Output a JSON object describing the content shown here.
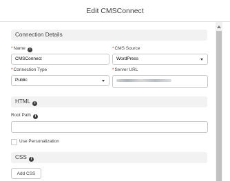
{
  "modal": {
    "title": "Edit CMSConnect"
  },
  "sections": {
    "connection_details": "Connection Details",
    "html": "HTML",
    "css": "CSS"
  },
  "fields": {
    "name": {
      "label": "Name",
      "value": "CMSConnect"
    },
    "cms_source": {
      "label": "CMS Source",
      "value": "WordPress"
    },
    "connection_type": {
      "label": "Connection Type",
      "value": "Public"
    },
    "server_url": {
      "label": "Server URL"
    },
    "root_path": {
      "label": "Root Path",
      "value": ""
    },
    "use_personalization": {
      "label": "Use Personalization",
      "checked": false
    }
  },
  "buttons": {
    "add_css": "Add CSS"
  },
  "required_marker": "*"
}
